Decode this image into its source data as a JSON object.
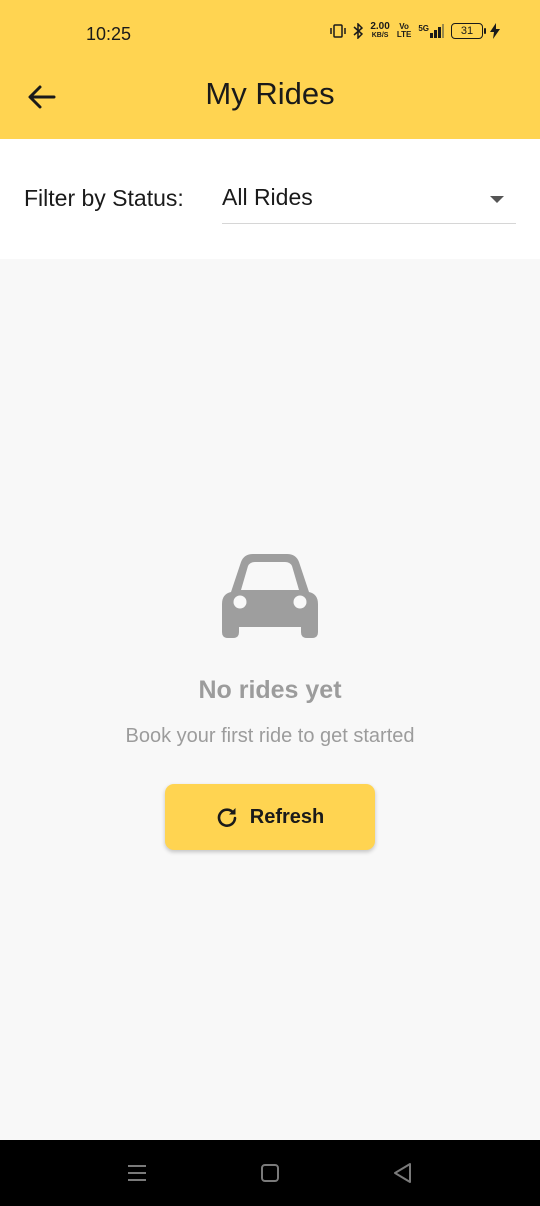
{
  "status_bar": {
    "time": "10:25",
    "speed_value": "2.00",
    "speed_unit": "KB/S",
    "volte_top": "Vo",
    "volte_bottom": "LTE",
    "network": "5G",
    "battery": "31"
  },
  "header": {
    "title": "My Rides",
    "back_icon": "arrow-left-icon",
    "background": "#ffd451"
  },
  "filter": {
    "label": "Filter by Status:",
    "selected": "All Rides"
  },
  "empty_state": {
    "icon": "car-icon",
    "title": "No rides yet",
    "subtitle": "Book your first ride to get started",
    "refresh_label": "Refresh",
    "refresh_icon": "refresh-icon"
  },
  "nav_bar": {
    "buttons": [
      "menu-icon",
      "home-icon",
      "back-triangle-icon"
    ]
  }
}
